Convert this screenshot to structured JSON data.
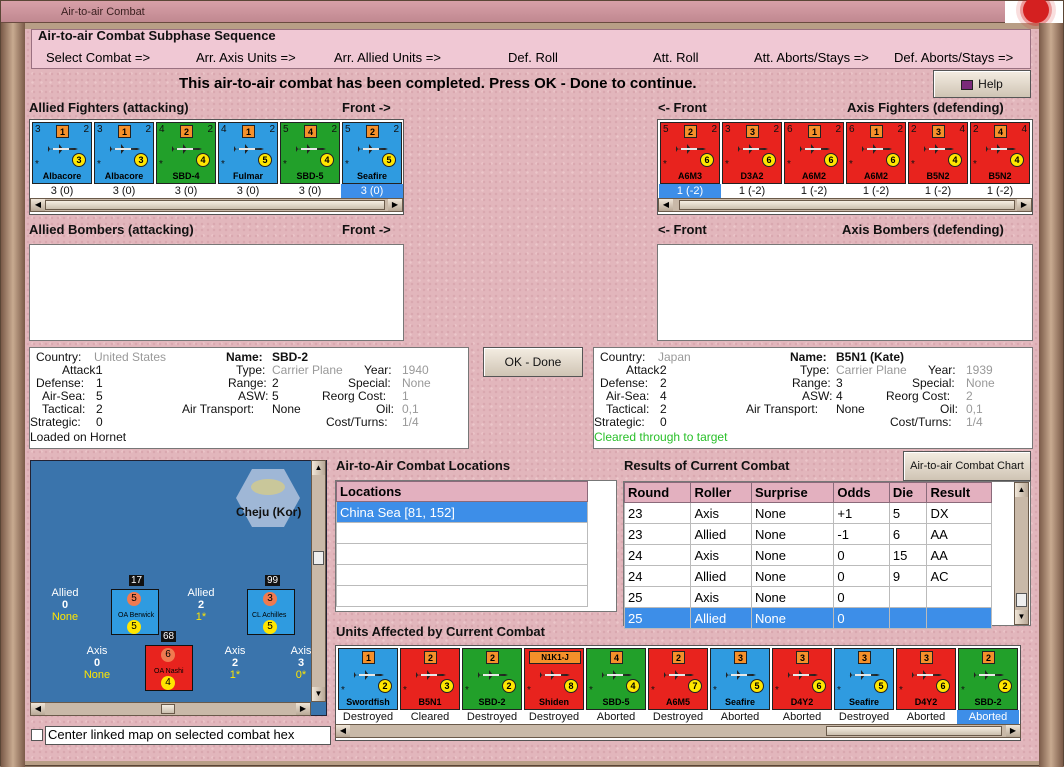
{
  "window": {
    "title": "Air-to-air Combat"
  },
  "subphase": {
    "title": "Air-to-air Combat Subphase Sequence",
    "steps": [
      "Select Combat =>",
      "Arr. Axis Units =>",
      "Arr. Allied Units =>",
      "Def. Roll",
      "Att. Roll",
      "Att. Aborts/Stays =>",
      "Def. Aborts/Stays =>"
    ]
  },
  "message": "This air-to-air combat has been completed.  Press OK - Done to continue.",
  "help_label": "Help",
  "allied_fighters": {
    "label": "Allied Fighters (attacking)",
    "front": "Front ->",
    "units": [
      {
        "name": "Albacore",
        "color": "#2f9be0",
        "tl": "3",
        "box": "1",
        "tr": "2",
        "circ": "3",
        "val": "3 (0)"
      },
      {
        "name": "Albacore",
        "color": "#2f9be0",
        "tl": "3",
        "box": "1",
        "tr": "2",
        "circ": "3",
        "val": "3 (0)"
      },
      {
        "name": "SBD-4",
        "color": "#22a02a",
        "tl": "4",
        "box": "2",
        "tr": "2",
        "circ": "4",
        "val": "3 (0)"
      },
      {
        "name": "Fulmar",
        "color": "#2f9be0",
        "tl": "4",
        "box": "1",
        "tr": "2",
        "circ": "5",
        "val": "3 (0)"
      },
      {
        "name": "SBD-5",
        "color": "#22a02a",
        "tl": "5",
        "box": "4",
        "tr": "2",
        "circ": "4",
        "val": "3 (0)"
      },
      {
        "name": "Seafire",
        "color": "#2f9be0",
        "tl": "5",
        "box": "2",
        "tr": "2",
        "circ": "5",
        "val": "3 (0)"
      }
    ]
  },
  "axis_fighters": {
    "label": "Axis Fighters (defending)",
    "front": "<- Front",
    "units": [
      {
        "name": "A6M3",
        "color": "#e8231e",
        "tl": "5",
        "box": "2",
        "tr": "2",
        "circ": "6",
        "val": "1 (-2)"
      },
      {
        "name": "D3A2",
        "color": "#e8231e",
        "tl": "3",
        "box": "3",
        "tr": "2",
        "circ": "6",
        "val": "1 (-2)"
      },
      {
        "name": "A6M2",
        "color": "#e8231e",
        "tl": "6",
        "box": "1",
        "tr": "2",
        "circ": "6",
        "val": "1 (-2)"
      },
      {
        "name": "A6M2",
        "color": "#e8231e",
        "tl": "6",
        "box": "1",
        "tr": "2",
        "circ": "6",
        "val": "1 (-2)"
      },
      {
        "name": "B5N2",
        "color": "#e8231e",
        "tl": "2",
        "box": "3",
        "tr": "4",
        "circ": "4",
        "val": "1 (-2)"
      },
      {
        "name": "B5N2",
        "color": "#e8231e",
        "tl": "2",
        "box": "4",
        "tr": "4",
        "circ": "4",
        "val": "1 (-2)"
      }
    ]
  },
  "allied_bombers": {
    "label": "Allied Bombers (attacking)",
    "front": "Front ->"
  },
  "axis_bombers": {
    "label": "Axis Bombers (defending)",
    "front": "<- Front"
  },
  "ok_label": "OK - Done",
  "allied_info": {
    "country_k": "Country:",
    "country": "United States",
    "name_k": "Name:",
    "name": "SBD-2",
    "attack": "1",
    "defense": "1",
    "airsea": "5",
    "tactical": "2",
    "strategic": "0",
    "type": "Carrier Plane",
    "range": "2",
    "asw": "5",
    "air_transport": "None",
    "year": "1940",
    "special": "None",
    "reorg": "1",
    "oil": "0,1",
    "cost": "1/4",
    "note": "Loaded on Hornet"
  },
  "axis_info": {
    "country_k": "Country:",
    "country": "Japan",
    "name_k": "Name:",
    "name": "B5N1 (Kate)",
    "attack": "2",
    "defense": "2",
    "airsea": "4",
    "tactical": "2",
    "strategic": "0",
    "type": "Carrier Plane",
    "range": "3",
    "asw": "4",
    "air_transport": "None",
    "year": "1939",
    "special": "None",
    "reorg": "2",
    "oil": "0,1",
    "cost": "1/4",
    "note": "Cleared through to target"
  },
  "info_keys": {
    "attack": "Attack:",
    "defense": "Defense:",
    "airsea": "Air-Sea:",
    "tactical": "Tactical:",
    "strategic": "Strategic:",
    "type": "Type:",
    "range": "Range:",
    "asw": "ASW:",
    "air_transport": "Air Transport:",
    "year": "Year:",
    "special": "Special:",
    "reorg": "Reorg Cost:",
    "oil": "Oil:",
    "cost": "Cost/Turns:"
  },
  "map": {
    "place": "Cheju (Kor)",
    "hexes": [
      {
        "title": "Allied",
        "value": "0",
        "sub": "None"
      },
      {
        "title": "Allied",
        "value": "2",
        "sub": "1*"
      },
      {
        "title": "Axis",
        "value": "0",
        "sub": "None"
      },
      {
        "title": "Axis",
        "value": "2",
        "sub": "1*"
      },
      {
        "title": "Axis",
        "value": "3",
        "sub": "0*"
      }
    ],
    "stack_counts": [
      "17",
      "99",
      "68"
    ],
    "unit_names": [
      "OA Berwick",
      "CL Achilles",
      "OA Nashi"
    ]
  },
  "center_map_label": "Center linked map on selected combat hex",
  "locations": {
    "title": "Air-to-Air Combat Locations",
    "header": "Locations",
    "rows": [
      "China Sea [81, 152]"
    ]
  },
  "results": {
    "title": "Results of Current Combat",
    "chart_button": "Air-to-air Combat Chart",
    "headers": [
      "Round",
      "Roller",
      "Surprise",
      "Odds",
      "Die",
      "Result"
    ],
    "rows": [
      [
        "23",
        "Axis",
        "None",
        "+1",
        "5",
        "DX"
      ],
      [
        "23",
        "Allied",
        "None",
        "-1",
        "6",
        "AA"
      ],
      [
        "24",
        "Axis",
        "None",
        "0",
        "15",
        "AA"
      ],
      [
        "24",
        "Allied",
        "None",
        "0",
        "9",
        "AC"
      ],
      [
        "25",
        "Axis",
        "None",
        "0",
        "",
        ""
      ],
      [
        "25",
        "Allied",
        "None",
        "0",
        "",
        ""
      ]
    ]
  },
  "affected": {
    "title": "Units Affected by Current Combat",
    "units": [
      {
        "name": "Swordfish",
        "color": "#2f9be0",
        "box": "1",
        "circ": "2",
        "status": "Destroyed"
      },
      {
        "name": "B5N1",
        "color": "#e8231e",
        "box": "2",
        "circ": "3",
        "status": "Cleared"
      },
      {
        "name": "SBD-2",
        "color": "#22a02a",
        "box": "2",
        "circ": "2",
        "status": "Destroyed"
      },
      {
        "name": "Shiden",
        "color": "#e8231e",
        "box": "N1K1-J",
        "circ": "8",
        "status": "Destroyed"
      },
      {
        "name": "SBD-5",
        "color": "#22a02a",
        "box": "4",
        "circ": "4",
        "status": "Aborted"
      },
      {
        "name": "A6M5",
        "color": "#e8231e",
        "box": "2",
        "circ": "7",
        "status": "Destroyed"
      },
      {
        "name": "Seafire",
        "color": "#2f9be0",
        "box": "3",
        "circ": "5",
        "status": "Aborted"
      },
      {
        "name": "D4Y2",
        "color": "#e8231e",
        "box": "3",
        "circ": "6",
        "status": "Aborted"
      },
      {
        "name": "Seafire",
        "color": "#2f9be0",
        "box": "3",
        "circ": "5",
        "status": "Destroyed"
      },
      {
        "name": "D4Y2",
        "color": "#e8231e",
        "box": "3",
        "circ": "6",
        "status": "Aborted"
      },
      {
        "name": "SBD-2",
        "color": "#22a02a",
        "box": "2",
        "circ": "2",
        "status": "Aborted"
      }
    ]
  }
}
